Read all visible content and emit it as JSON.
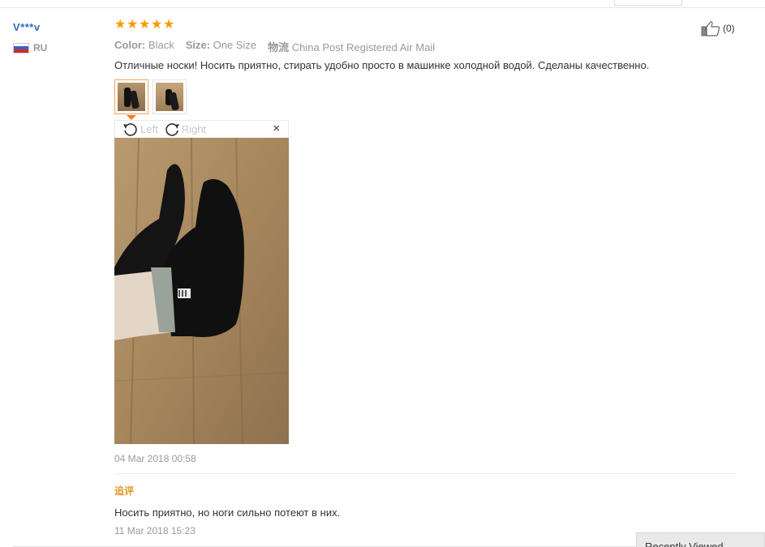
{
  "user": {
    "name": "V***v",
    "country": "RU"
  },
  "rating": {
    "stars": 5
  },
  "attributes": [
    {
      "key": "Color:",
      "value": "Black"
    },
    {
      "key": "Size:",
      "value": "One Size"
    },
    {
      "key": "物流",
      "value": "China Post Registered Air Mail"
    }
  ],
  "helpful": {
    "count": "(0)"
  },
  "review": {
    "text": "Отличные носки! Носить приятно, стирать удобно просто в машинке холодной водой. Сделаны качественно.",
    "date": "04 Mar 2018 00:58"
  },
  "viewer": {
    "rotate_left": "Left",
    "rotate_right": "Right",
    "close": "×"
  },
  "followup": {
    "label": "追评",
    "text": "Носить приятно, но ноги сильно потеют в них.",
    "date": "11 Mar 2018 15:23"
  },
  "recently_viewed": {
    "label": "Recently Viewed"
  },
  "colors": {
    "star": "#ff9a00",
    "username": "#2a6ebb",
    "followup_label": "#e69524",
    "active_thumb": "#f6a25a"
  }
}
